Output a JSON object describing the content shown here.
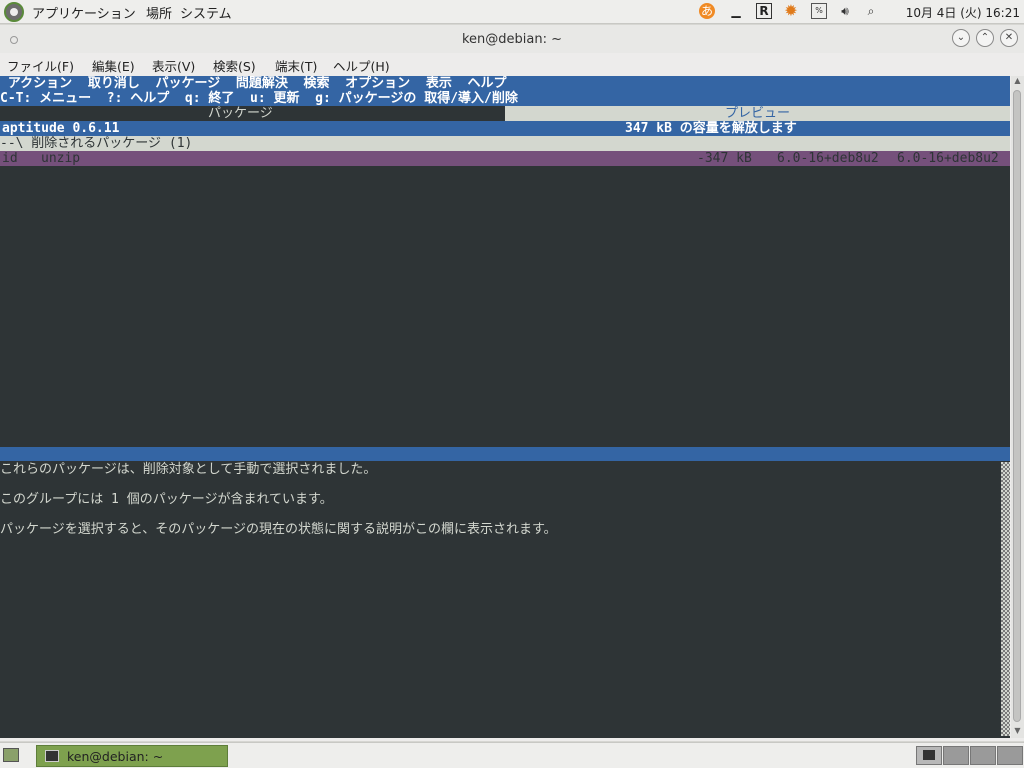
{
  "top_panel": {
    "menus": [
      "アプリケーション",
      "場所",
      "システム"
    ],
    "tray_icons": [
      "input-method-icon",
      "minimize-icon",
      "r-icon",
      "update-gear-icon",
      "network-icon",
      "volume-icon",
      "search-icon"
    ],
    "clock": "10月 4日 (火) 16:21"
  },
  "window": {
    "title": "ken@debian: ~",
    "menu": [
      "ファイル(F)",
      "編集(E)",
      "表示(V)",
      "検索(S)",
      "端末(T)",
      "ヘルプ(H)"
    ]
  },
  "aptitude": {
    "menu_line": " アクション  取り消し  パッケージ  問題解決  検索  オプション  表示  ヘルプ",
    "help_line": "C-T: メニュー  ?: ヘルプ  q: 終了  u: 更新  g: パッケージの 取得/導入/削除",
    "tab_packages": "パッケージ",
    "tab_preview": "プレビュー",
    "version": "aptitude 0.6.11",
    "status": "347 kB の容量を解放します",
    "group": "--\\ 削除されるパッケージ (1)",
    "package_row": {
      "state": "id",
      "name": "unzip",
      "size": "-347 kB",
      "current_version": "6.0-16+deb8u2",
      "candidate_version": "6.0-16+deb8u2"
    },
    "desc_line1": "これらのパッケージは、削除対象として手動で選択されました。",
    "desc_line2": "このグループには 1 個のパッケージが含まれています。",
    "desc_line3": "パッケージを選択すると、そのパッケージの現在の状態に関する説明がこの欄に表示されます。"
  },
  "taskbar": {
    "task_label": "ken@debian: ~"
  },
  "colors": {
    "terminal_bg": "#2e3436",
    "bar_blue": "#3465a4",
    "bar_grey": "#d3d7cf",
    "highlight_purple": "#75507b",
    "task_green": "#7ea14e"
  }
}
